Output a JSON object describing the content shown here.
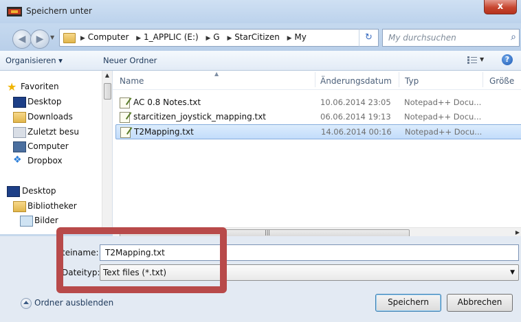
{
  "window": {
    "title": "Speichern unter",
    "close_label": "x"
  },
  "address": {
    "crumbs": [
      "Computer",
      "1_APPLIC (E:)",
      "G",
      "StarCitizen",
      "My"
    ],
    "search_placeholder": "My durchsuchen"
  },
  "toolbar": {
    "organize_label": "Organisieren ▾",
    "new_folder_label": "Neuer Ordner",
    "help_label": "?"
  },
  "navpane": {
    "items": [
      {
        "label": "Favoriten",
        "icon": "star-icon"
      },
      {
        "label": "Desktop",
        "icon": "desktop-icon"
      },
      {
        "label": "Downloads",
        "icon": "downloads-icon"
      },
      {
        "label": "Zuletzt besu",
        "icon": "recent-icon"
      },
      {
        "label": "Computer",
        "icon": "computer-icon"
      },
      {
        "label": "Dropbox",
        "icon": "dropbox-icon"
      },
      {
        "label": "Desktop",
        "icon": "desktop-icon"
      },
      {
        "label": "Bibliotheker",
        "icon": "library-icon"
      },
      {
        "label": "Bilder",
        "icon": "pictures-icon"
      }
    ]
  },
  "columns": {
    "name": "Name",
    "date": "Änderungsdatum",
    "type": "Typ",
    "size": "Größe"
  },
  "files": [
    {
      "name": "AC 0.8 Notes.txt",
      "date": "10.06.2014 23:05",
      "type": "Notepad++ Docu...",
      "selected": false
    },
    {
      "name": "starcitizen_joystick_mapping.txt",
      "date": "06.06.2014 19:13",
      "type": "Notepad++ Docu...",
      "selected": false
    },
    {
      "name": "T2Mapping.txt",
      "date": "14.06.2014 00:16",
      "type": "Notepad++ Docu...",
      "selected": true
    }
  ],
  "form": {
    "filename_label": "teiname:",
    "filename_value": "T2Mapping.txt",
    "filetype_label": "Dateityp:",
    "filetype_value": "Text files (*.txt)"
  },
  "footer": {
    "hide_folders_label": "Ordner ausblenden",
    "save_label": "Speichern",
    "cancel_label": "Abbrechen"
  },
  "colors": {
    "annotation_red": "#b84a4a",
    "selection_blue": "#c2dcfb"
  }
}
